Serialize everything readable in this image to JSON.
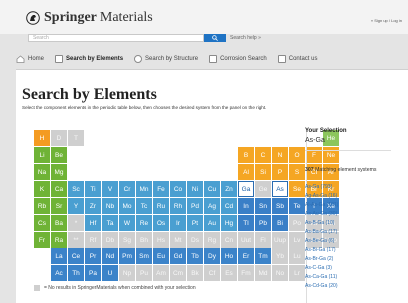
{
  "header": {
    "brand_bold": "Springer",
    "brand_light": "Materials",
    "signin": "» Sign up / Log in"
  },
  "search": {
    "placeholder": "Search",
    "help": "Search help »"
  },
  "nav": {
    "items": [
      {
        "label": "Home"
      },
      {
        "label": "Search by Elements"
      },
      {
        "label": "Search by Structure"
      },
      {
        "label": "Corrosion Search"
      },
      {
        "label": "Contact us"
      }
    ]
  },
  "page": {
    "title": "Search by Elements",
    "description": "Select the component elements in the periodic table below, then chooses the desired system from the panel on the right."
  },
  "colors": {
    "accent": "#1f73c4",
    "selected_border": "#2a6cb1"
  },
  "periodic_table": {
    "main_rows": [
      [
        "H",
        "D",
        "T",
        "",
        "",
        "",
        "",
        "",
        "",
        "",
        "",
        "",
        "",
        "",
        "",
        "",
        "",
        "He"
      ],
      [
        "Li",
        "Be",
        "",
        "",
        "",
        "",
        "",
        "",
        "",
        "",
        "",
        "",
        "B",
        "C",
        "N",
        "O",
        "F",
        "Ne"
      ],
      [
        "Na",
        "Mg",
        "",
        "",
        "",
        "",
        "",
        "",
        "",
        "",
        "",
        "",
        "Al",
        "Si",
        "P",
        "S",
        "Cl",
        "Ar"
      ],
      [
        "K",
        "Ca",
        "Sc",
        "Ti",
        "V",
        "Cr",
        "Mn",
        "Fe",
        "Co",
        "Ni",
        "Cu",
        "Zn",
        "Ga",
        "Ge",
        "As",
        "Se",
        "Br",
        "Kr"
      ],
      [
        "Rb",
        "Sr",
        "Y",
        "Zr",
        "Nb",
        "Mo",
        "Tc",
        "Ru",
        "Rh",
        "Pd",
        "Ag",
        "Cd",
        "In",
        "Sn",
        "Sb",
        "Te",
        "I",
        "Xe"
      ],
      [
        "Cs",
        "Ba",
        "*",
        "Hf",
        "Ta",
        "W",
        "Re",
        "Os",
        "Ir",
        "Pt",
        "Au",
        "Hg",
        "Tl",
        "Pb",
        "Bi",
        "Po",
        "At",
        "Rn"
      ],
      [
        "Fr",
        "Ra",
        "**",
        "Rf",
        "Db",
        "Sg",
        "Bh",
        "Hs",
        "Mt",
        "Ds",
        "Rg",
        "Cn",
        "Uut",
        "Fl",
        "Uup",
        "Lv",
        "Uus",
        "Uuo"
      ]
    ],
    "f_rows": [
      [
        "La",
        "Ce",
        "Pr",
        "Nd",
        "Pm",
        "Sm",
        "Eu",
        "Gd",
        "Tb",
        "Dy",
        "Ho",
        "Er",
        "Tm",
        "Yb",
        "Lu"
      ],
      [
        "Ac",
        "Th",
        "Pa",
        "U",
        "Np",
        "Pu",
        "Am",
        "Cm",
        "Bk",
        "Cf",
        "Es",
        "Fm",
        "Md",
        "No",
        "Lr"
      ]
    ],
    "selected_elements": [
      "Ga",
      "As"
    ],
    "legend_text": "= No results in SpringerMaterials when combined with your selection"
  },
  "selection_panel": {
    "heading": "Your Selection",
    "value": "As-Ga",
    "match_count": "307",
    "match_text": "Matching element systems",
    "systems": [
      "As-Ga (793)",
      "Ag-As-Ga (16)",
      "Al-As-Ga (101)",
      "As-Au-Ga (30)",
      "As-B-Ga (10)",
      "As-Ba-Ga (17)",
      "As-Be-Ga (6)",
      "As-Bi-Ga (17)",
      "As-Br-Ga (2)",
      "As-C-Ga (3)",
      "As-Ca-Ga (11)",
      "As-Cd-Ga (20)"
    ]
  }
}
